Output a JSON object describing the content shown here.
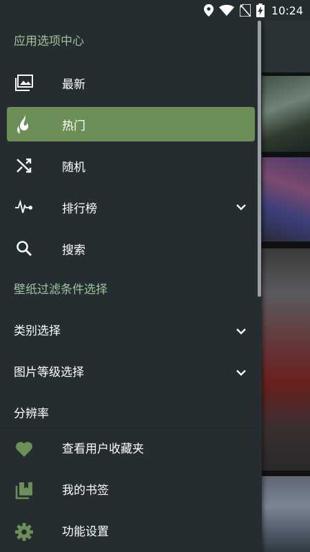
{
  "status_bar": {
    "time": "10:24",
    "icons": [
      "location-icon",
      "wifi-icon",
      "no-sim-icon",
      "battery-charging-icon"
    ]
  },
  "drawer": {
    "section_app": "应用选项中心",
    "nav": [
      {
        "label": "最新",
        "icon": "images-icon",
        "active": false
      },
      {
        "label": "热门",
        "icon": "fire-icon",
        "active": true
      },
      {
        "label": "随机",
        "icon": "shuffle-icon",
        "active": false
      },
      {
        "label": "排行榜",
        "icon": "pulse-icon",
        "active": false,
        "expandable": true
      },
      {
        "label": "搜索",
        "icon": "search-icon",
        "active": false
      }
    ],
    "section_filter": "壁纸过滤条件选择",
    "filters": [
      {
        "label": "类别选择",
        "expandable": true
      },
      {
        "label": "图片等级选择",
        "expandable": true
      },
      {
        "label": "分辨率",
        "expandable": false
      }
    ],
    "bottom": [
      {
        "label": "查看用户收藏夹",
        "icon": "heart-icon"
      },
      {
        "label": "我的书签",
        "icon": "bookmarks-icon"
      },
      {
        "label": "功能设置",
        "icon": "gear-icon"
      }
    ]
  },
  "colors": {
    "drawer_bg": "#262d31",
    "accent": "#6b8f56",
    "section_text": "#9fc49d",
    "icon_green": "#6b8f56"
  }
}
